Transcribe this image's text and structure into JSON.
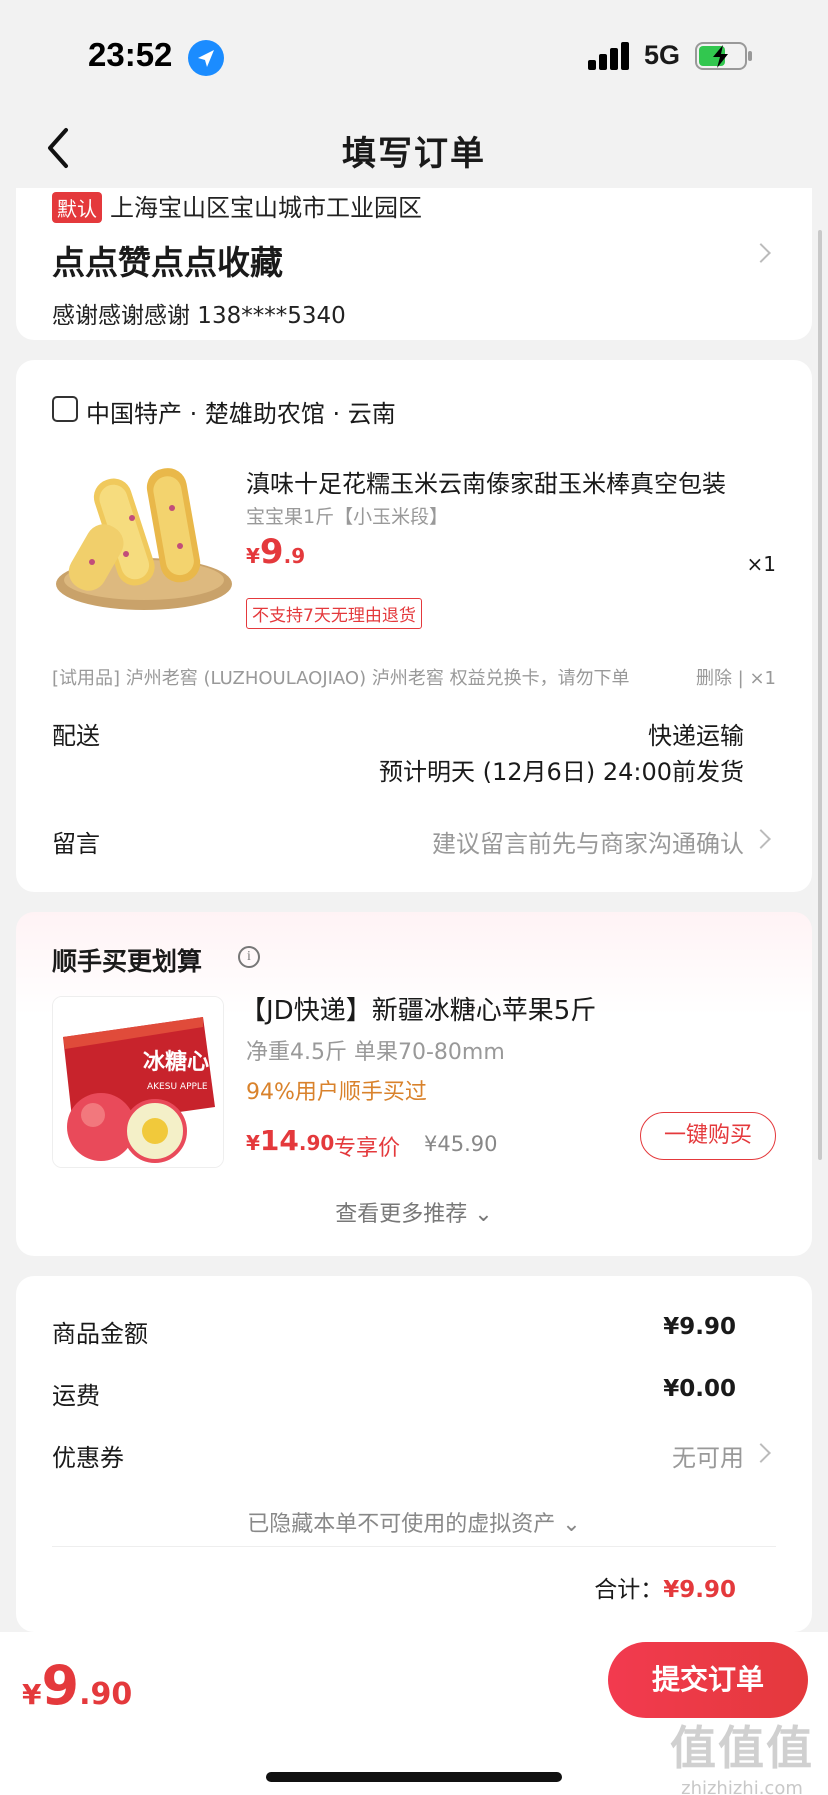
{
  "status_bar": {
    "time": "23:52",
    "network": "5G"
  },
  "nav": {
    "title": "填写订单"
  },
  "address": {
    "default_tag": "默认",
    "region": "上海宝山区宝山城市工业园区",
    "detail": "点点赞点点收藏",
    "contact": "感谢感谢感谢  138****5340"
  },
  "order": {
    "shop_name": "中国特产 · 楚雄助农馆 · 云南",
    "product": {
      "title": "滇味十足花糯玉米云南傣家甜玉米棒真空包装",
      "spec": "宝宝果1斤【小玉米段】",
      "price_currency": "¥",
      "price_int": "9",
      "price_dec": ".9",
      "qty": "×1",
      "tag": "不支持7天无理由退货"
    },
    "gift": {
      "text": "[试用品] 泸州老窖 (LUZHOULAOJIAO) 泸州老窖  权益兑换卡，请勿下单",
      "action": "删除 | ×1"
    },
    "delivery_label": "配送",
    "delivery_method": "快递运输",
    "delivery_eta": "预计明天 (12月6日) 24:00前发货",
    "remark_label": "留言",
    "remark_hint": "建议留言前先与商家沟通确认"
  },
  "recommend": {
    "title": "顺手买更划算",
    "info_icon": "i",
    "item": {
      "name": "【JD快递】新疆冰糖心苹果5斤",
      "spec": "净重4.5斤 单果70-80mm",
      "social": "94%用户顺手买过",
      "price_currency": "¥",
      "price_int": "14",
      "price_dec": ".90",
      "exclusive": "专享价",
      "original": "¥45.90",
      "button": "一键购买",
      "box_text": "冰糖心",
      "box_text_en": "AKESU APPLE"
    },
    "more": "查看更多推荐 ⌄"
  },
  "summary": {
    "goods_label": "商品金额",
    "goods_value": "¥9.90",
    "shipping_label": "运费",
    "shipping_value": "¥0.00",
    "coupon_label": "优惠券",
    "coupon_value": "无可用",
    "hidden_assets": "已隐藏本单不可使用的虚拟资产 ⌄",
    "total_label": "合计：",
    "total_value": "¥9.90"
  },
  "bottom": {
    "price_currency": "¥",
    "price_int": "9",
    "price_dec": ".90",
    "submit": "提交订单",
    "watermark_big": "值值值",
    "watermark_small": "zhizhizhi.com"
  },
  "colors": {
    "accent": "#e4393c",
    "orange": "#d9822b",
    "muted": "#999999",
    "background": "#f2f2f2"
  }
}
